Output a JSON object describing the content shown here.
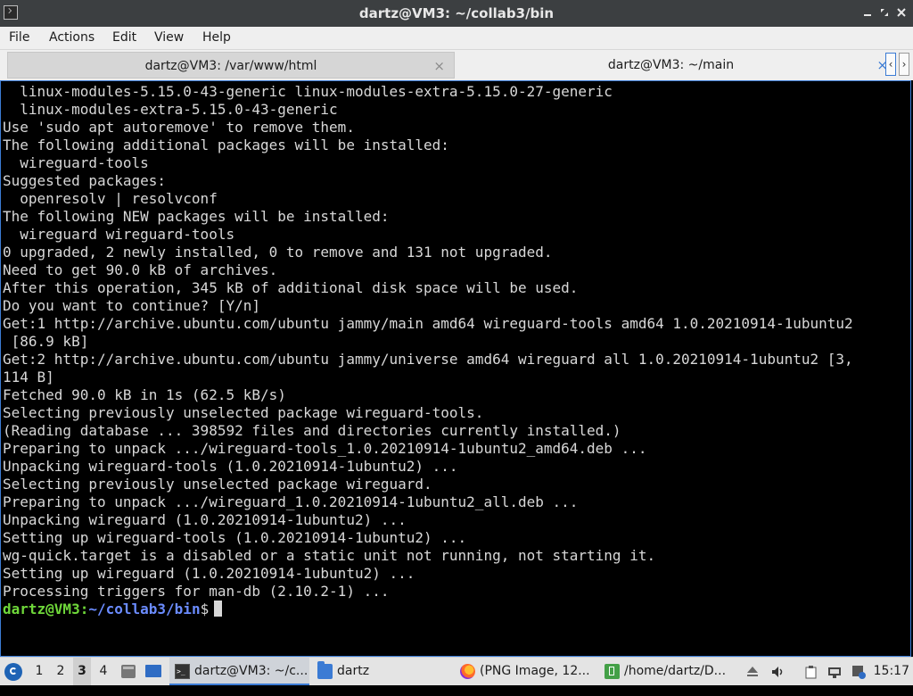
{
  "window": {
    "title": "dartz@VM3: ~/collab3/bin",
    "minimize_icon": "minimize-icon",
    "maximize_icon": "maximize-icon",
    "close_icon": "close-icon"
  },
  "menu": {
    "items": [
      "File",
      "Actions",
      "Edit",
      "View",
      "Help"
    ]
  },
  "tabs": [
    {
      "label": "dartz@VM3: /var/www/html",
      "close": "×",
      "active": false
    },
    {
      "label": "dartz@VM3: ~/main",
      "close": "×",
      "active": true
    }
  ],
  "tab_scroll": {
    "left": "‹",
    "right": "›"
  },
  "terminal": {
    "lines": [
      "  linux-modules-5.15.0-43-generic linux-modules-extra-5.15.0-27-generic",
      "  linux-modules-extra-5.15.0-43-generic",
      "Use 'sudo apt autoremove' to remove them.",
      "The following additional packages will be installed:",
      "  wireguard-tools",
      "Suggested packages:",
      "  openresolv | resolvconf",
      "The following NEW packages will be installed:",
      "  wireguard wireguard-tools",
      "0 upgraded, 2 newly installed, 0 to remove and 131 not upgraded.",
      "Need to get 90.0 kB of archives.",
      "After this operation, 345 kB of additional disk space will be used.",
      "Do you want to continue? [Y/n]",
      "Get:1 http://archive.ubuntu.com/ubuntu jammy/main amd64 wireguard-tools amd64 1.0.20210914-1ubuntu2",
      " [86.9 kB]",
      "Get:2 http://archive.ubuntu.com/ubuntu jammy/universe amd64 wireguard all 1.0.20210914-1ubuntu2 [3,",
      "114 B]",
      "Fetched 90.0 kB in 1s (62.5 kB/s)",
      "Selecting previously unselected package wireguard-tools.",
      "(Reading database ... 398592 files and directories currently installed.)",
      "Preparing to unpack .../wireguard-tools_1.0.20210914-1ubuntu2_amd64.deb ...",
      "Unpacking wireguard-tools (1.0.20210914-1ubuntu2) ...",
      "Selecting previously unselected package wireguard.",
      "Preparing to unpack .../wireguard_1.0.20210914-1ubuntu2_all.deb ...",
      "Unpacking wireguard (1.0.20210914-1ubuntu2) ...",
      "Setting up wireguard-tools (1.0.20210914-1ubuntu2) ...",
      "wg-quick.target is a disabled or a static unit not running, not starting it.",
      "Setting up wireguard (1.0.20210914-1ubuntu2) ...",
      "Processing triggers for man-db (2.10.2-1) ..."
    ],
    "prompt": {
      "user_host": "dartz@VM3",
      "separator": ":",
      "path": "~/collab3/bin",
      "symbol": "$"
    },
    "colors": {
      "background": "#000000",
      "text": "#d8d8d8",
      "user": "#6fd83a",
      "path": "#6b8cff"
    }
  },
  "taskbar": {
    "workspaces": [
      "1",
      "2",
      "3",
      "4"
    ],
    "current_workspace": "3",
    "tasks": [
      {
        "label": "dartz@VM3: ~/c...",
        "icon": "terminal-icon",
        "active": true
      },
      {
        "label": "dartz",
        "icon": "folder-icon",
        "active": false
      },
      {
        "label": "(PNG Image, 12...",
        "icon": "firefox-icon",
        "active": false
      },
      {
        "label": "/home/dartz/D...",
        "icon": "text-editor-icon",
        "active": false
      }
    ],
    "tray_icons": [
      "eject-icon",
      "volume-icon",
      "clipboard-icon",
      "network-icon",
      "update-icon"
    ],
    "clock": "15:17"
  }
}
